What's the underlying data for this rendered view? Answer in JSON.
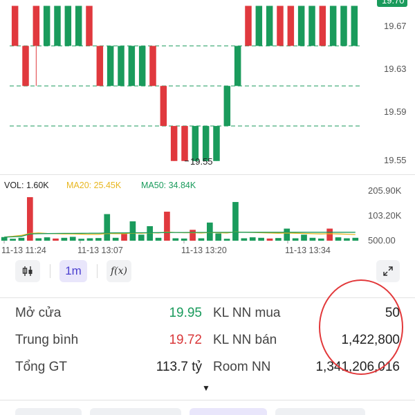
{
  "chart_data": [
    {
      "type": "candlestick",
      "y_ticks": [
        "19.70",
        "19.67",
        "19.63",
        "19.59",
        "19.55"
      ],
      "current_price": "19.70",
      "low_label": "19.55",
      "candles": [
        {
          "dir": "down",
          "o": 19.7,
          "c": 19.66,
          "h": 19.7,
          "l": 19.66
        },
        {
          "dir": "down",
          "o": 19.66,
          "c": 19.62,
          "h": 19.66,
          "l": 19.62
        },
        {
          "dir": "down",
          "o": 19.7,
          "c": 19.66,
          "h": 19.7,
          "l": 19.62
        },
        {
          "dir": "up",
          "o": 19.66,
          "c": 19.7,
          "h": 19.7,
          "l": 19.66
        },
        {
          "dir": "up",
          "o": 19.66,
          "c": 19.7,
          "h": 19.7,
          "l": 19.66
        },
        {
          "dir": "up",
          "o": 19.66,
          "c": 19.7,
          "h": 19.7,
          "l": 19.66
        },
        {
          "dir": "up",
          "o": 19.66,
          "c": 19.7,
          "h": 19.7,
          "l": 19.66
        },
        {
          "dir": "down",
          "o": 19.7,
          "c": 19.66,
          "h": 19.7,
          "l": 19.66
        },
        {
          "dir": "down",
          "o": 19.66,
          "c": 19.62,
          "h": 19.66,
          "l": 19.62
        },
        {
          "dir": "up",
          "o": 19.62,
          "c": 19.66,
          "h": 19.66,
          "l": 19.62
        },
        {
          "dir": "up",
          "o": 19.62,
          "c": 19.66,
          "h": 19.66,
          "l": 19.62
        },
        {
          "dir": "up",
          "o": 19.62,
          "c": 19.66,
          "h": 19.66,
          "l": 19.62
        },
        {
          "dir": "up",
          "o": 19.62,
          "c": 19.66,
          "h": 19.66,
          "l": 19.62
        },
        {
          "dir": "down",
          "o": 19.66,
          "c": 19.62,
          "h": 19.66,
          "l": 19.62
        },
        {
          "dir": "down",
          "o": 19.62,
          "c": 19.58,
          "h": 19.62,
          "l": 19.58
        },
        {
          "dir": "down",
          "o": 19.58,
          "c": 19.545,
          "h": 19.58,
          "l": 19.545
        },
        {
          "dir": "down",
          "o": 19.58,
          "c": 19.545,
          "h": 19.58,
          "l": 19.545
        },
        {
          "dir": "up",
          "o": 19.545,
          "c": 19.58,
          "h": 19.58,
          "l": 19.545
        },
        {
          "dir": "up",
          "o": 19.545,
          "c": 19.58,
          "h": 19.58,
          "l": 19.545
        },
        {
          "dir": "up",
          "o": 19.545,
          "c": 19.58,
          "h": 19.58,
          "l": 19.545
        },
        {
          "dir": "up",
          "o": 19.58,
          "c": 19.62,
          "h": 19.62,
          "l": 19.58
        },
        {
          "dir": "up",
          "o": 19.62,
          "c": 19.66,
          "h": 19.66,
          "l": 19.62
        },
        {
          "dir": "down",
          "o": 19.7,
          "c": 19.66,
          "h": 19.7,
          "l": 19.66
        },
        {
          "dir": "up",
          "o": 19.66,
          "c": 19.7,
          "h": 19.7,
          "l": 19.66
        },
        {
          "dir": "up",
          "o": 19.66,
          "c": 19.7,
          "h": 19.7,
          "l": 19.66
        },
        {
          "dir": "down",
          "o": 19.7,
          "c": 19.66,
          "h": 19.7,
          "l": 19.66
        },
        {
          "dir": "down",
          "o": 19.7,
          "c": 19.66,
          "h": 19.7,
          "l": 19.66
        },
        {
          "dir": "up",
          "o": 19.66,
          "c": 19.7,
          "h": 19.7,
          "l": 19.66
        },
        {
          "dir": "up",
          "o": 19.66,
          "c": 19.7,
          "h": 19.7,
          "l": 19.66
        },
        {
          "dir": "down",
          "o": 19.7,
          "c": 19.66,
          "h": 19.7,
          "l": 19.66
        },
        {
          "dir": "up",
          "o": 19.66,
          "c": 19.7,
          "h": 19.7,
          "l": 19.66
        },
        {
          "dir": "up",
          "o": 19.66,
          "c": 19.7,
          "h": 19.7,
          "l": 19.66
        },
        {
          "dir": "up",
          "o": 19.66,
          "c": 19.7,
          "h": 19.7,
          "l": 19.66
        }
      ],
      "ylim": [
        19.54,
        19.71
      ]
    },
    {
      "type": "bar",
      "legend": {
        "vol": "VOL: 1.60K",
        "ma20": "MA20: 25.45K",
        "ma50": "MA50: 34.84K"
      },
      "y_ticks": [
        "205.90K",
        "103.20K",
        "500.00"
      ],
      "x_ticks": [
        "11-13 11:24",
        "11-13 13:07",
        "11-13 13:20",
        "11-13 13:34"
      ],
      "ylim": [
        0,
        205900
      ],
      "volumes": [
        {
          "v": 15000,
          "dir": "up"
        },
        {
          "v": 8000,
          "dir": "up"
        },
        {
          "v": 12000,
          "dir": "up"
        },
        {
          "v": 180000,
          "dir": "down"
        },
        {
          "v": 10000,
          "dir": "up"
        },
        {
          "v": 14000,
          "dir": "up"
        },
        {
          "v": 9000,
          "dir": "down"
        },
        {
          "v": 12000,
          "dir": "up"
        },
        {
          "v": 16000,
          "dir": "up"
        },
        {
          "v": 8000,
          "dir": "up"
        },
        {
          "v": 10000,
          "dir": "up"
        },
        {
          "v": 11000,
          "dir": "up"
        },
        {
          "v": 110000,
          "dir": "up"
        },
        {
          "v": 12000,
          "dir": "up"
        },
        {
          "v": 28000,
          "dir": "down"
        },
        {
          "v": 80000,
          "dir": "up"
        },
        {
          "v": 25000,
          "dir": "up"
        },
        {
          "v": 60000,
          "dir": "up"
        },
        {
          "v": 12000,
          "dir": "up"
        },
        {
          "v": 120000,
          "dir": "down"
        },
        {
          "v": 10000,
          "dir": "up"
        },
        {
          "v": 9000,
          "dir": "up"
        },
        {
          "v": 45000,
          "dir": "down"
        },
        {
          "v": 10000,
          "dir": "up"
        },
        {
          "v": 75000,
          "dir": "up"
        },
        {
          "v": 30000,
          "dir": "up"
        },
        {
          "v": 8000,
          "dir": "up"
        },
        {
          "v": 160000,
          "dir": "up"
        },
        {
          "v": 10000,
          "dir": "up"
        },
        {
          "v": 14000,
          "dir": "up"
        },
        {
          "v": 12000,
          "dir": "up"
        },
        {
          "v": 9000,
          "dir": "down"
        },
        {
          "v": 11000,
          "dir": "up"
        },
        {
          "v": 50000,
          "dir": "up"
        },
        {
          "v": 10000,
          "dir": "up"
        },
        {
          "v": 25000,
          "dir": "up"
        },
        {
          "v": 12000,
          "dir": "up"
        },
        {
          "v": 9000,
          "dir": "up"
        },
        {
          "v": 50000,
          "dir": "down"
        },
        {
          "v": 14000,
          "dir": "up"
        },
        {
          "v": 10000,
          "dir": "up"
        },
        {
          "v": 12000,
          "dir": "up"
        }
      ],
      "ma20": [
        15000,
        18000,
        22000,
        30000,
        32000,
        30000,
        29000,
        28000,
        28000,
        27000,
        26000,
        26000,
        30000,
        29000,
        29000,
        32000,
        31000,
        33000,
        32000,
        36000,
        34000,
        33000,
        33000,
        32000,
        34000,
        33000,
        32000,
        36000,
        35000,
        34000,
        33000,
        32000,
        31000,
        32000,
        31000,
        30000,
        29000,
        28000,
        29000,
        28000,
        27000,
        25450
      ],
      "ma50": [
        15000,
        16000,
        18000,
        28000,
        29000,
        29500,
        30000,
        30200,
        30400,
        30600,
        30800,
        31000,
        32000,
        32200,
        32400,
        32800,
        33000,
        33200,
        33400,
        33800,
        34000,
        34100,
        34200,
        34300,
        34400,
        34500,
        34500,
        34800,
        34800,
        34800,
        34800,
        34800,
        34800,
        34800,
        34800,
        34800,
        34800,
        34800,
        34800,
        34800,
        34800,
        34840
      ]
    }
  ],
  "colors": {
    "up": "#1a9b5c",
    "down": "#e0393e",
    "ma20": "#e8b61e",
    "ma50": "#1a9b5c",
    "axis_text": "#555555"
  },
  "toolbar": {
    "chart_type_icon": "candlestick-icon",
    "interval_label": "1m",
    "indicator_label": "f(x)",
    "expand_icon": "expand-icon"
  },
  "info": {
    "open_label": "Mở cửa",
    "open_value": "19.95",
    "avg_label": "Trung bình",
    "avg_value": "19.72",
    "total_label": "Tổng GT",
    "total_value": "113.7 tỷ",
    "nn_buy_label": "KL NN mua",
    "nn_buy_value": "50",
    "nn_sell_label": "KL NN bán",
    "nn_sell_value": "1,422,800",
    "room_label": "Room NN",
    "room_value": "1,341,206,016"
  },
  "more_icon": "caret-down-icon"
}
